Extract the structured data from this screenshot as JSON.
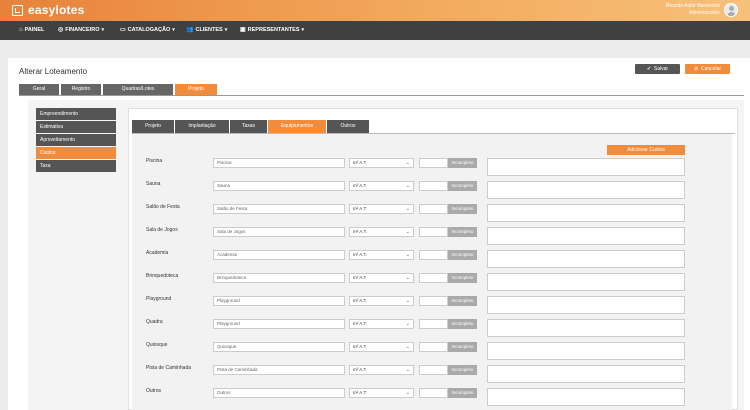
{
  "app": {
    "brand": "easylotes"
  },
  "user": {
    "name": "Ricardo Aulor Barrientos",
    "role": "Administrador"
  },
  "nav": [
    {
      "label": "PAINEL",
      "icon": "home-icon",
      "glyph": "⌂",
      "chevron": false
    },
    {
      "label": "FINANCEIRO",
      "icon": "money-icon",
      "glyph": "◎",
      "chevron": true
    },
    {
      "label": "CATALOGAÇÃO",
      "icon": "book-icon",
      "glyph": "▭",
      "chevron": true
    },
    {
      "label": "CLIENTES",
      "icon": "users-icon",
      "glyph": "👥",
      "chevron": true
    },
    {
      "label": "REPRESENTANTES",
      "icon": "briefcase-icon",
      "glyph": "▣",
      "chevron": true
    }
  ],
  "page": {
    "title": "Alterar Loteamento",
    "save_label": "Salvar",
    "cancel_label": "Cancelar"
  },
  "top_tabs": [
    "Geral",
    "Registro",
    "Quadras/Lotes",
    "Projeto"
  ],
  "active_top_tab": "Projeto",
  "sidebar": [
    "Empreendimento",
    "Estimativa",
    "Aproveitamento",
    "Custos",
    "Taxa"
  ],
  "active_sidebar": "Custos",
  "sub_tabs": [
    "Projeto",
    "Implantação",
    "Taxas",
    "Equipamentos",
    "Outros"
  ],
  "active_sub_tab": "Equipamentos",
  "add_cost_label": "Adicionar Custos",
  "equipment": [
    {
      "label": "Piscina",
      "placeholder": "Piscina",
      "unit": "m² A.T.",
      "status": "Incompleto"
    },
    {
      "label": "Sauna",
      "placeholder": "Sauna",
      "unit": "m² A.T.",
      "status": "Incompleto"
    },
    {
      "label": "Salão de Festa",
      "placeholder": "Salão de Festa",
      "unit": "m² A.T.",
      "status": "Incompleto"
    },
    {
      "label": "Sala de Jogos",
      "placeholder": "Sala de Jogos",
      "unit": "m² A.T.",
      "status": "Incompleto"
    },
    {
      "label": "Academia",
      "placeholder": "Academia",
      "unit": "m² A.T.",
      "status": "Incompleto"
    },
    {
      "label": "Brinquedoteca",
      "placeholder": "Brinquedoteca",
      "unit": "m² A.T.",
      "status": "Incompleto"
    },
    {
      "label": "Playground",
      "placeholder": "Playground",
      "unit": "m² A.T.",
      "status": "Incompleto"
    },
    {
      "label": "Quadra",
      "placeholder": "Playground",
      "unit": "m² A.T.",
      "status": "Incompleto"
    },
    {
      "label": "Quiosque",
      "placeholder": "Quiosque",
      "unit": "m² A.T.",
      "status": "Incompleto"
    },
    {
      "label": "Pista de Caminhada",
      "placeholder": "Pista de Caminhada",
      "unit": "m² A.T.",
      "status": "Incompleto"
    },
    {
      "label": "Outros",
      "placeholder": "Outros",
      "unit": "m² A.T.",
      "status": "Incompleto"
    }
  ],
  "colors": {
    "accent": "#f08c3c",
    "nav": "#404040",
    "tab": "#555555"
  }
}
